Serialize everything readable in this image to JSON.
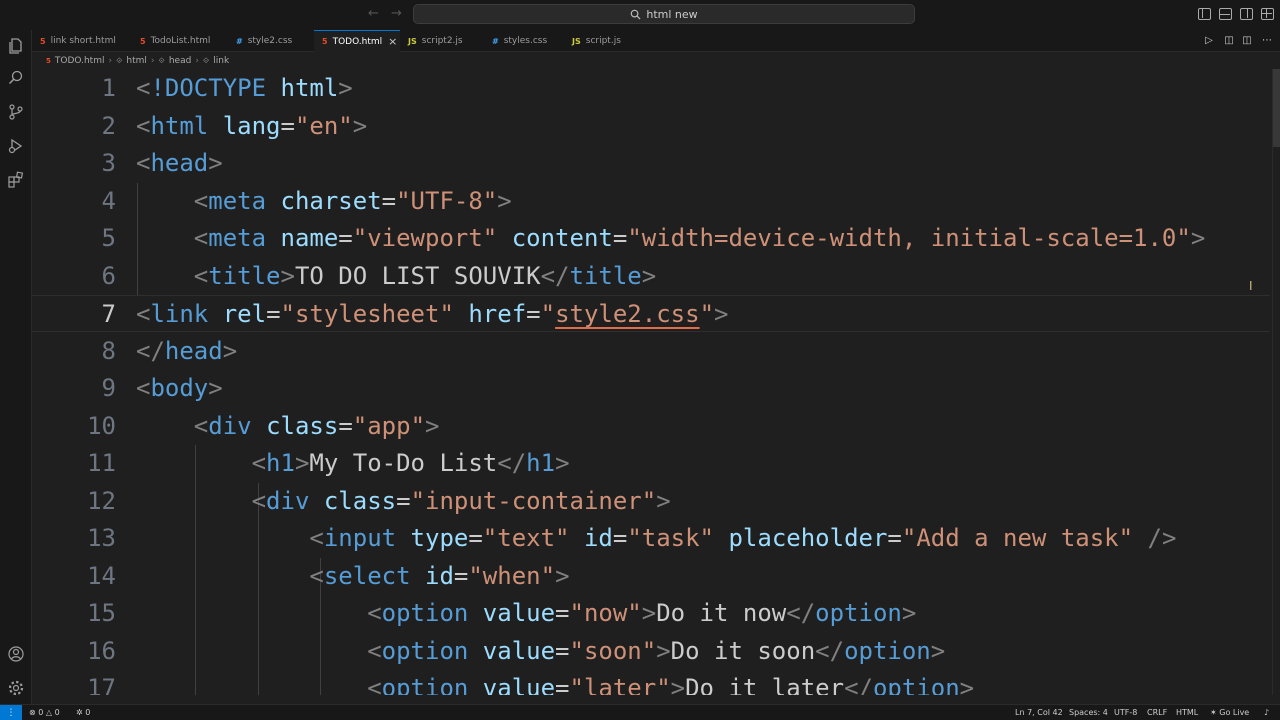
{
  "titlebar": {
    "search_text": "html new",
    "search_icon": "search-icon"
  },
  "tabs": [
    {
      "label": "link short.html",
      "type": "html",
      "icon_label": "5"
    },
    {
      "label": "TodoList.html",
      "type": "html",
      "icon_label": "5"
    },
    {
      "label": "style2.css",
      "type": "css",
      "icon_label": "#"
    },
    {
      "label": "TODO.html",
      "type": "html",
      "icon_label": "5",
      "active": true
    },
    {
      "label": "script2.js",
      "type": "js",
      "icon_label": "JS"
    },
    {
      "label": "styles.css",
      "type": "css",
      "icon_label": "#"
    },
    {
      "label": "script.js",
      "type": "js",
      "icon_label": "JS"
    }
  ],
  "breadcrumb": {
    "file": "TODO.html",
    "el1": "html",
    "el2": "head",
    "el3": "link"
  },
  "editor": {
    "current_line": 7,
    "lines": [
      {
        "n": "1",
        "tokens": [
          [
            "p",
            "<"
          ],
          [
            "d",
            "!DOCTYPE"
          ],
          [
            "t",
            " "
          ],
          [
            "a",
            "html"
          ],
          [
            "p",
            ">"
          ]
        ]
      },
      {
        "n": "2",
        "tokens": [
          [
            "p",
            "<"
          ],
          [
            "g",
            "html"
          ],
          [
            "t",
            " "
          ],
          [
            "a",
            "lang"
          ],
          [
            "t",
            "="
          ],
          [
            "s",
            "\"en\""
          ],
          [
            "p",
            ">"
          ]
        ]
      },
      {
        "n": "3",
        "tokens": [
          [
            "p",
            "<"
          ],
          [
            "g",
            "head"
          ],
          [
            "p",
            ">"
          ]
        ]
      },
      {
        "n": "4",
        "tokens": [
          [
            "t",
            "    "
          ],
          [
            "p",
            "<"
          ],
          [
            "g",
            "meta"
          ],
          [
            "t",
            " "
          ],
          [
            "a",
            "charset"
          ],
          [
            "t",
            "="
          ],
          [
            "s",
            "\"UTF-8\""
          ],
          [
            "p",
            ">"
          ]
        ]
      },
      {
        "n": "5",
        "tokens": [
          [
            "t",
            "    "
          ],
          [
            "p",
            "<"
          ],
          [
            "g",
            "meta"
          ],
          [
            "t",
            " "
          ],
          [
            "a",
            "name"
          ],
          [
            "t",
            "="
          ],
          [
            "s",
            "\"viewport\""
          ],
          [
            "t",
            " "
          ],
          [
            "a",
            "content"
          ],
          [
            "t",
            "="
          ],
          [
            "s",
            "\"width=device-width, initial-scale=1.0\""
          ],
          [
            "p",
            ">"
          ]
        ]
      },
      {
        "n": "6",
        "tokens": [
          [
            "t",
            "    "
          ],
          [
            "p",
            "<"
          ],
          [
            "g",
            "title"
          ],
          [
            "p",
            ">"
          ],
          [
            "t",
            "TO DO LIST SOUVIK"
          ],
          [
            "p",
            "</"
          ],
          [
            "g",
            "title"
          ],
          [
            "p",
            ">"
          ]
        ]
      },
      {
        "n": "7",
        "tokens": [
          [
            "p",
            "<"
          ],
          [
            "g",
            "link"
          ],
          [
            "t",
            " "
          ],
          [
            "a",
            "rel"
          ],
          [
            "t",
            "="
          ],
          [
            "s",
            "\"stylesheet\""
          ],
          [
            "t",
            " "
          ],
          [
            "a",
            "href"
          ],
          [
            "t",
            "="
          ],
          [
            "s",
            "\""
          ],
          [
            "sq",
            "style2.css"
          ],
          [
            "s",
            "\""
          ],
          [
            "p",
            ">"
          ]
        ]
      },
      {
        "n": "8",
        "tokens": [
          [
            "p",
            "</"
          ],
          [
            "g",
            "head"
          ],
          [
            "p",
            ">"
          ]
        ]
      },
      {
        "n": "9",
        "tokens": [
          [
            "p",
            "<"
          ],
          [
            "g",
            "body"
          ],
          [
            "p",
            ">"
          ]
        ]
      },
      {
        "n": "10",
        "tokens": [
          [
            "t",
            "    "
          ],
          [
            "p",
            "<"
          ],
          [
            "g",
            "div"
          ],
          [
            "t",
            " "
          ],
          [
            "a",
            "class"
          ],
          [
            "t",
            "="
          ],
          [
            "s",
            "\"app\""
          ],
          [
            "p",
            ">"
          ]
        ]
      },
      {
        "n": "11",
        "tokens": [
          [
            "t",
            "        "
          ],
          [
            "p",
            "<"
          ],
          [
            "g",
            "h1"
          ],
          [
            "p",
            ">"
          ],
          [
            "t",
            "My To-Do List"
          ],
          [
            "p",
            "</"
          ],
          [
            "g",
            "h1"
          ],
          [
            "p",
            ">"
          ]
        ]
      },
      {
        "n": "12",
        "tokens": [
          [
            "t",
            "        "
          ],
          [
            "p",
            "<"
          ],
          [
            "g",
            "div"
          ],
          [
            "t",
            " "
          ],
          [
            "a",
            "class"
          ],
          [
            "t",
            "="
          ],
          [
            "s",
            "\"input-container\""
          ],
          [
            "p",
            ">"
          ]
        ]
      },
      {
        "n": "13",
        "tokens": [
          [
            "t",
            "            "
          ],
          [
            "p",
            "<"
          ],
          [
            "g",
            "input"
          ],
          [
            "t",
            " "
          ],
          [
            "a",
            "type"
          ],
          [
            "t",
            "="
          ],
          [
            "s",
            "\"text\""
          ],
          [
            "t",
            " "
          ],
          [
            "a",
            "id"
          ],
          [
            "t",
            "="
          ],
          [
            "s",
            "\"task\""
          ],
          [
            "t",
            " "
          ],
          [
            "a",
            "placeholder"
          ],
          [
            "t",
            "="
          ],
          [
            "s",
            "\"Add a new task\""
          ],
          [
            "t",
            " "
          ],
          [
            "p",
            "/>"
          ]
        ]
      },
      {
        "n": "14",
        "tokens": [
          [
            "t",
            "            "
          ],
          [
            "p",
            "<"
          ],
          [
            "g",
            "select"
          ],
          [
            "t",
            " "
          ],
          [
            "a",
            "id"
          ],
          [
            "t",
            "="
          ],
          [
            "s",
            "\"when\""
          ],
          [
            "p",
            ">"
          ]
        ]
      },
      {
        "n": "15",
        "tokens": [
          [
            "t",
            "                "
          ],
          [
            "p",
            "<"
          ],
          [
            "g",
            "option"
          ],
          [
            "t",
            " "
          ],
          [
            "a",
            "value"
          ],
          [
            "t",
            "="
          ],
          [
            "s",
            "\"now\""
          ],
          [
            "p",
            ">"
          ],
          [
            "t",
            "Do it now"
          ],
          [
            "p",
            "</"
          ],
          [
            "g",
            "option"
          ],
          [
            "p",
            ">"
          ]
        ]
      },
      {
        "n": "16",
        "tokens": [
          [
            "t",
            "                "
          ],
          [
            "p",
            "<"
          ],
          [
            "g",
            "option"
          ],
          [
            "t",
            " "
          ],
          [
            "a",
            "value"
          ],
          [
            "t",
            "="
          ],
          [
            "s",
            "\"soon\""
          ],
          [
            "p",
            ">"
          ],
          [
            "t",
            "Do it soon"
          ],
          [
            "p",
            "</"
          ],
          [
            "g",
            "option"
          ],
          [
            "p",
            ">"
          ]
        ]
      },
      {
        "n": "17",
        "tokens": [
          [
            "t",
            "                "
          ],
          [
            "p",
            "<"
          ],
          [
            "g",
            "option"
          ],
          [
            "t",
            " "
          ],
          [
            "a",
            "value"
          ],
          [
            "t",
            "="
          ],
          [
            "s",
            "\"later\""
          ],
          [
            "p",
            ">"
          ],
          [
            "t",
            "Do it later"
          ],
          [
            "p",
            "</"
          ],
          [
            "g",
            "option"
          ],
          [
            "p",
            ">"
          ]
        ]
      }
    ]
  },
  "statusbar": {
    "errors": "0",
    "warnings": "0",
    "ports": "0",
    "position": "Ln 7, Col 42",
    "spaces": "Spaces: 4",
    "encoding": "UTF-8",
    "eol": "CRLF",
    "language": "HTML",
    "golive": "Go Live"
  },
  "colors": {
    "accent": "#0078d4",
    "tag": "#569cd6",
    "attr": "#9cdcfe",
    "string": "#ce9178",
    "html_icon": "#e44d26",
    "css_icon": "#42a5f5",
    "js_icon": "#cbcb41"
  }
}
